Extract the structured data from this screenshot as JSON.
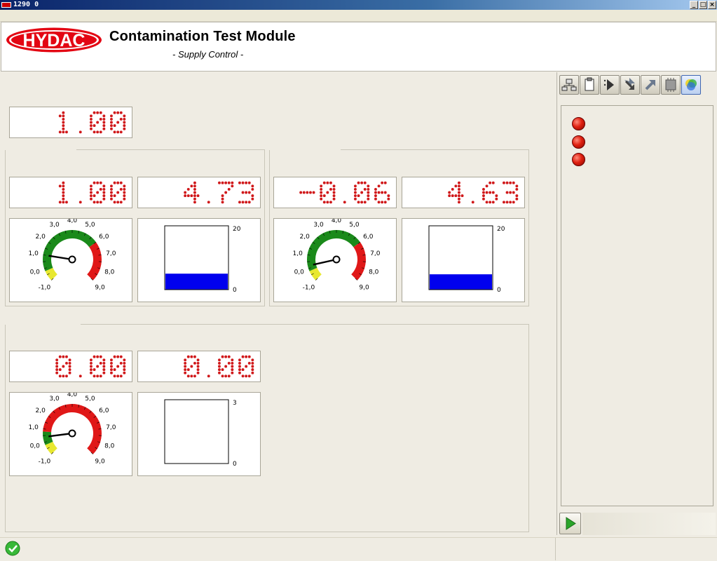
{
  "window": {
    "title": "1290 0"
  },
  "header": {
    "brand": "HYDAC",
    "title": "Contamination Test Module",
    "subtitle": "- Supply Control -"
  },
  "colors": {
    "lcd": "#d0181a",
    "gauge_green": "#1a8a1a",
    "gauge_red": "#e01818",
    "gauge_yellow": "#e8e830",
    "bar_fill": "#0000ee",
    "led": "#e02010"
  },
  "top_display": {
    "value": "1.00"
  },
  "groups": [
    {
      "lcd_left": "1.00",
      "lcd_right": "4.73",
      "gauge": {
        "labels": [
          "-1,0",
          "0,0",
          "1,0",
          "2,0",
          "3,0",
          "4,0",
          "5,0",
          "6,0",
          "7,0",
          "8,0",
          "9,0"
        ],
        "value": 1.0,
        "green_max": 6.0
      },
      "bar": {
        "max_label": "20",
        "min_label": "0",
        "level": 0.25
      }
    },
    {
      "lcd_left": "-0.06",
      "lcd_right": "4.63",
      "gauge": {
        "labels": [
          "-1,0",
          "0,0",
          "1,0",
          "2,0",
          "3,0",
          "4,0",
          "5,0",
          "6,0",
          "7,0",
          "8,0",
          "9,0"
        ],
        "value": 0.2,
        "green_max": 6.0
      },
      "bar": {
        "max_label": "20",
        "min_label": "0",
        "level": 0.24
      }
    },
    {
      "lcd_left": "0.00",
      "lcd_right": "0.00",
      "gauge": {
        "labels": [
          "-1,0",
          "0,0",
          "1,0",
          "2,0",
          "3,0",
          "4,0",
          "5,0",
          "6,0",
          "7,0",
          "8,0",
          "9,0"
        ],
        "value": 0.4,
        "green_max": 0.8
      },
      "bar": {
        "max_label": "3",
        "min_label": "0",
        "level": 0.0
      }
    }
  ],
  "toolbar": {
    "icons": [
      "network-icon",
      "clipboard-icon",
      "step-forward-icon",
      "arrow-down-icon",
      "arrow-up-icon",
      "chip-icon",
      "color-circle-icon"
    ],
    "active_index": 6
  },
  "status_leds": {
    "count": 3,
    "state": "off"
  },
  "footer": {
    "status_icon": "ok-check-icon",
    "play_icon": "play-icon"
  }
}
